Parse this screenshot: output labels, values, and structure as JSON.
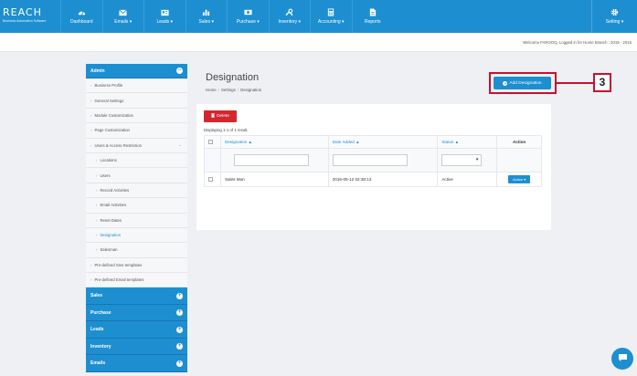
{
  "logo": {
    "brand": "REACH",
    "tagline": "Business Automation Software"
  },
  "nav": {
    "dashboard": "Dashboard",
    "emails": "Emails ▾",
    "leads": "Leads ▾",
    "sales": "Sales ▾",
    "purchase": "Purchase ▾",
    "inventory": "Inventory ▾",
    "accounting": "Accounting ▾",
    "reports": "Reports",
    "setting": "Setting ▾"
  },
  "welcome": "Welcome FAROOQ, Logged in for Home Branch : 2015 - 2016",
  "sidebar": {
    "admin": "Admin",
    "items": {
      "business_profile": "Business Profile",
      "general_settings": "General Settings",
      "module_customization": "Module Customization",
      "page_customization": "Page Customization",
      "users_access": "Users & Access Restriction",
      "locations": "Locations",
      "users": "Users",
      "record_activities": "Record Activities",
      "email_activities": "Email Activities",
      "reset_dates": "Reset Dates",
      "designation": "Designation",
      "salesman": "Salesman",
      "sms_templates": "Pre-defined Sms templates",
      "email_templates": "Pre-defined Email templates"
    },
    "sections": {
      "sales": "Sales",
      "purchase": "Purchase",
      "leads": "Leads",
      "inventory": "Inventory",
      "emails": "Emails"
    }
  },
  "page": {
    "title": "Designation",
    "breadcrumb": [
      "Home",
      "Settings",
      "Designation"
    ],
    "add_button": "Add Designation",
    "delete_button": "Delete",
    "displaying": "Displaying 1-1 of 1 result.",
    "callout_number": "3"
  },
  "table": {
    "headers": {
      "designation": "Designation ▲",
      "date_added": "Date Added ▲",
      "status": "Status ▲",
      "action": "Action"
    },
    "rows": [
      {
        "designation": "Sales Man",
        "date_added": "2016-05-12 02:38:13",
        "status": "Active",
        "action": "Action ▾"
      }
    ]
  },
  "colors": {
    "primary": "#1d8fd1",
    "danger": "#d22730",
    "callout": "#c8102e"
  }
}
